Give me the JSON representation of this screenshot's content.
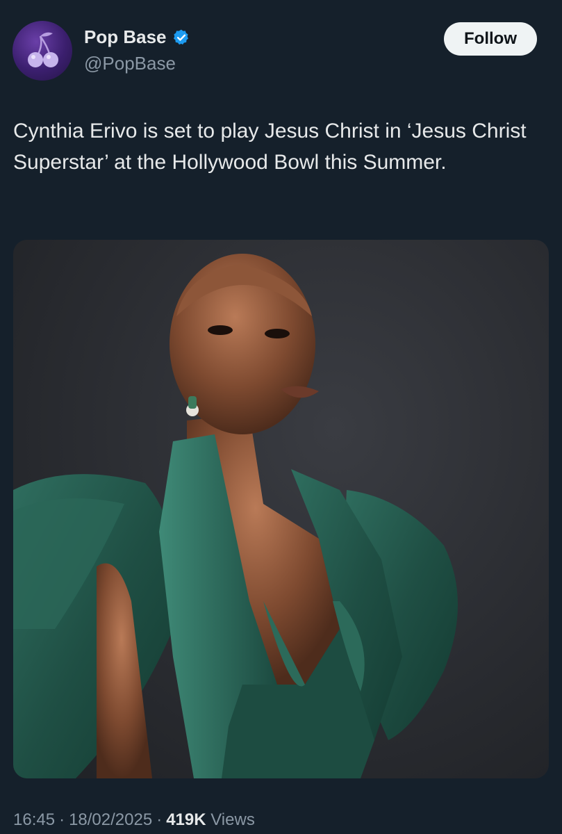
{
  "author": {
    "display_name": "Pop Base",
    "handle": "@PopBase",
    "verified": true,
    "avatar_icon": "cherries-icon",
    "verified_color": "#1d9bf0"
  },
  "follow_button": {
    "label": "Follow"
  },
  "tweet": {
    "text": "Cynthia Erivo is set to play Jesus Christ in ‘Jesus Christ Superstar’ at the Hollywood Bowl this Summer."
  },
  "media": {
    "type": "photo"
  },
  "meta": {
    "time": "16:45",
    "separator": "·",
    "date": "18/02/2025",
    "views_count": "419K",
    "views_label": "Views"
  },
  "colors": {
    "background": "#15202b",
    "text_primary": "#e7e9ea",
    "text_secondary": "#8b98a5",
    "button_bg": "#eff3f4"
  }
}
